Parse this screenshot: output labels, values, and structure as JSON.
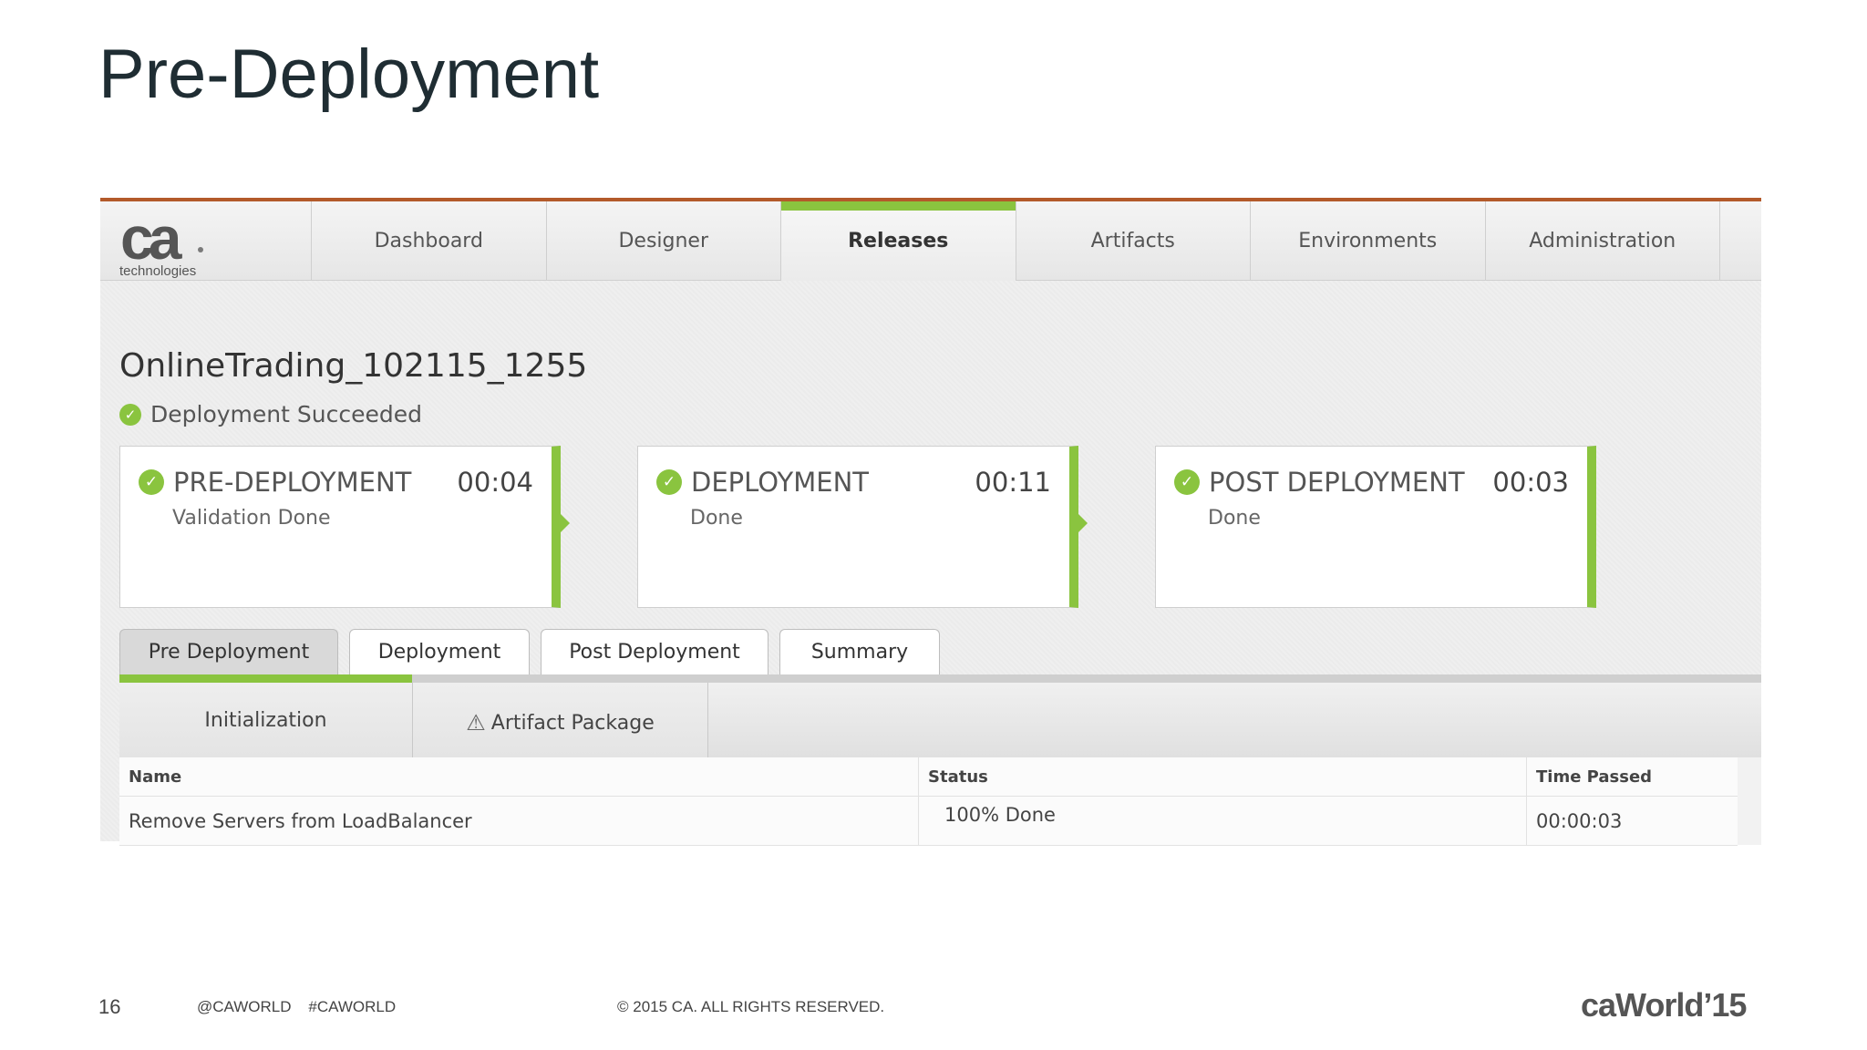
{
  "slide": {
    "title": "Pre-Deployment"
  },
  "logo": {
    "mark": "ca",
    "subtitle": "technologies"
  },
  "nav": {
    "items": [
      {
        "label": "Dashboard"
      },
      {
        "label": "Designer"
      },
      {
        "label": "Releases",
        "active": true
      },
      {
        "label": "Artifacts"
      },
      {
        "label": "Environments"
      },
      {
        "label": "Administration"
      }
    ]
  },
  "release": {
    "name": "OnlineTrading_102115_1255",
    "status": "Deployment Succeeded"
  },
  "stages": [
    {
      "title": "PRE-DEPLOYMENT",
      "time": "00:04",
      "sub": "Validation Done",
      "icon": "check-circle-icon"
    },
    {
      "title": "DEPLOYMENT",
      "time": "00:11",
      "sub": "Done",
      "icon": "check-circle-icon"
    },
    {
      "title": "POST DEPLOYMENT",
      "time": "00:03",
      "sub": "Done",
      "icon": "check-circle-icon"
    }
  ],
  "tabs": [
    {
      "label": "Pre Deployment",
      "active": true
    },
    {
      "label": "Deployment"
    },
    {
      "label": "Post Deployment"
    },
    {
      "label": "Summary"
    }
  ],
  "subtabs": [
    {
      "label": "Initialization",
      "active": true
    },
    {
      "label": "Artifact Package",
      "icon": "warning-icon"
    }
  ],
  "table": {
    "columns": [
      "Name",
      "Status",
      "Time Passed"
    ],
    "rows": [
      {
        "name": "Remove Servers from LoadBalancer",
        "status": "100% Done",
        "time": "00:00:03"
      }
    ]
  },
  "footer": {
    "page": "16",
    "social": "@CAWORLD    #CAWORLD",
    "copyright": "© 2015 CA. ALL RIGHTS RESERVED.",
    "brand": "caWorld",
    "brand_year": "’15"
  },
  "colors": {
    "accent_green": "#8ac43f",
    "top_rule": "#b35a2a"
  }
}
